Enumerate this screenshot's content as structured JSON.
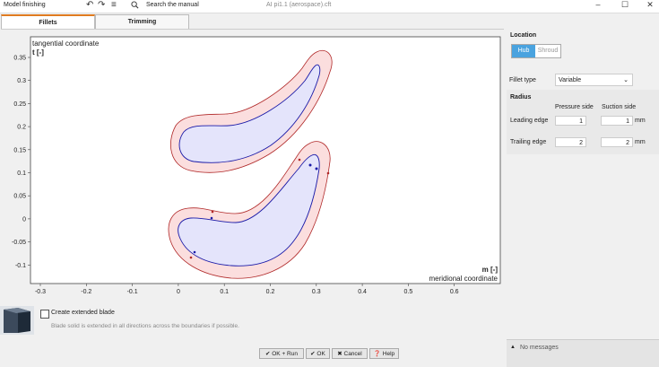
{
  "titlebar": {
    "title": "Model finishing",
    "search_placeholder": "Search the manual",
    "document": "AI pi1.1 (aerospace).cft",
    "undo_icon": "undo-icon",
    "redo_icon": "redo-icon",
    "menu_icon": "hamburger-icon"
  },
  "tabs": [
    {
      "label": "Fillets",
      "active": true
    },
    {
      "label": "Trimming",
      "active": false
    }
  ],
  "plot": {
    "ylabel_top": "tangential coordinate",
    "ylabel_unit": "t [-]",
    "xlabel_unit": "m [-]",
    "xlabel_bottom": "meridional coordinate",
    "x_ticks": [
      "-0.3",
      "-0.2",
      "-0.1",
      "0",
      "0.1",
      "0.2",
      "0.3",
      "0.4",
      "0.5",
      "0.6"
    ],
    "y_ticks": [
      "0.35",
      "0.3",
      "0.25",
      "0.2",
      "0.15",
      "0.1",
      "0.05",
      "0",
      "-0.05",
      "-0.1"
    ],
    "colors": {
      "blade_fill": "#e4e4fb",
      "blade_line": "#1a1aa8",
      "fillet_fill": "#fbdede",
      "fillet_line": "#b02828"
    }
  },
  "panel": {
    "location_title": "Location",
    "location_hub": "Hub",
    "location_shroud": "Shroud",
    "fillet_type_label": "Fillet type",
    "fillet_type_value": "Variable",
    "radius_title": "Radius",
    "col_pressure": "Pressure side",
    "col_suction": "Suction side",
    "leading_label": "Leading edge",
    "leading_pressure": "1",
    "leading_suction": "1",
    "leading_unit": "mm",
    "trailing_label": "Trailing edge",
    "trailing_pressure": "2",
    "trailing_suction": "2",
    "trailing_unit": "mm",
    "accent": "#4aa3df"
  },
  "bottom": {
    "checkbox_label": "Create extended blade",
    "checkbox_checked": false,
    "hint": "Blade solid is extended in all directions across the boundaries if possible.",
    "buttons": {
      "ok_run": "✔ OK + Run",
      "ok": "✔ OK",
      "cancel": "✖ Cancel",
      "help": "❓ Help"
    },
    "status": "No messages"
  }
}
